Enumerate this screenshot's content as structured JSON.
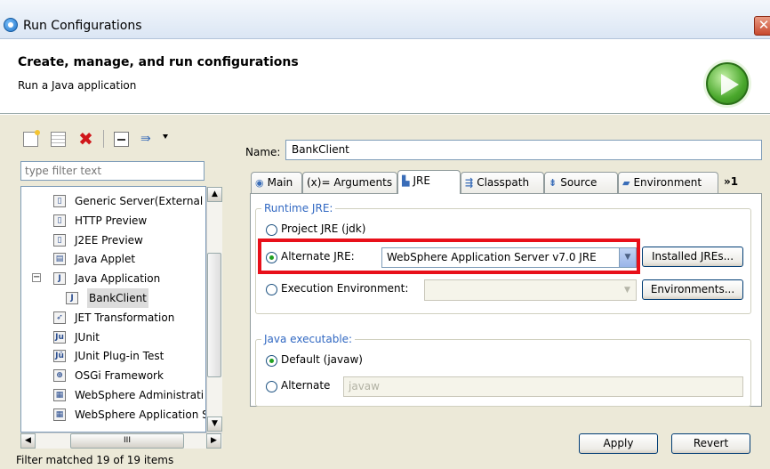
{
  "window": {
    "title": "Run Configurations",
    "close_glyph": "✕"
  },
  "header": {
    "title": "Create, manage, and run configurations",
    "subtitle": "Run a Java application"
  },
  "toolbar": {
    "icons": [
      "new-config-icon",
      "duplicate-icon",
      "delete-icon",
      "collapse-all-icon",
      "filter-icon"
    ]
  },
  "filter": {
    "placeholder": "type filter text",
    "status": "Filter matched 19 of 19 items"
  },
  "tree": {
    "items": [
      {
        "label": "Generic Server(External",
        "icon": "server-icon",
        "level": 1
      },
      {
        "label": "HTTP Preview",
        "icon": "server-icon",
        "level": 1
      },
      {
        "label": "J2EE Preview",
        "icon": "server-icon",
        "level": 1
      },
      {
        "label": "Java Applet",
        "icon": "applet-icon",
        "level": 1
      },
      {
        "label": "Java Application",
        "icon": "java-app-icon",
        "level": 1,
        "expanded": true
      },
      {
        "label": "BankClient",
        "icon": "java-app-icon",
        "level": 2,
        "selected": true
      },
      {
        "label": "JET Transformation",
        "icon": "jet-icon",
        "level": 1
      },
      {
        "label": "JUnit",
        "icon": "junit-icon",
        "level": 1
      },
      {
        "label": "JUnit Plug-in Test",
        "icon": "junit-plugin-icon",
        "level": 1
      },
      {
        "label": "OSGi Framework",
        "icon": "osgi-icon",
        "level": 1
      },
      {
        "label": "WebSphere Administrati",
        "icon": "websphere-icon",
        "level": 1
      },
      {
        "label": "WebSphere Application S",
        "icon": "websphere-icon",
        "level": 1
      }
    ],
    "hscroll_glyph": "III"
  },
  "config": {
    "name_label": "Name:",
    "name_value": "BankClient",
    "tabs": [
      {
        "label": "Main",
        "icon": "main-tab-icon"
      },
      {
        "label": "(x)= Arguments",
        "icon": "arguments-tab-icon"
      },
      {
        "label": "JRE",
        "icon": "jre-tab-icon",
        "active": true
      },
      {
        "label": "Classpath",
        "icon": "classpath-tab-icon"
      },
      {
        "label": "Source",
        "icon": "source-tab-icon"
      },
      {
        "label": "Environment",
        "icon": "environment-tab-icon"
      }
    ],
    "tab_overflow": "»1",
    "runtime_jre": {
      "group_label": "Runtime JRE:",
      "project_jre": "Project JRE (jdk)",
      "alternate_jre": "Alternate JRE:",
      "alternate_jre_value": "WebSphere Application Server v7.0 JRE",
      "installed_jres": "Installed JREs...",
      "execution_env": "Execution Environment:",
      "environments": "Environments...",
      "selected": "alternate"
    },
    "java_exec": {
      "group_label": "Java executable:",
      "default": "Default (javaw)",
      "alternate": "Alternate",
      "alternate_value": "javaw",
      "selected": "default"
    },
    "apply": "Apply",
    "revert": "Revert"
  }
}
